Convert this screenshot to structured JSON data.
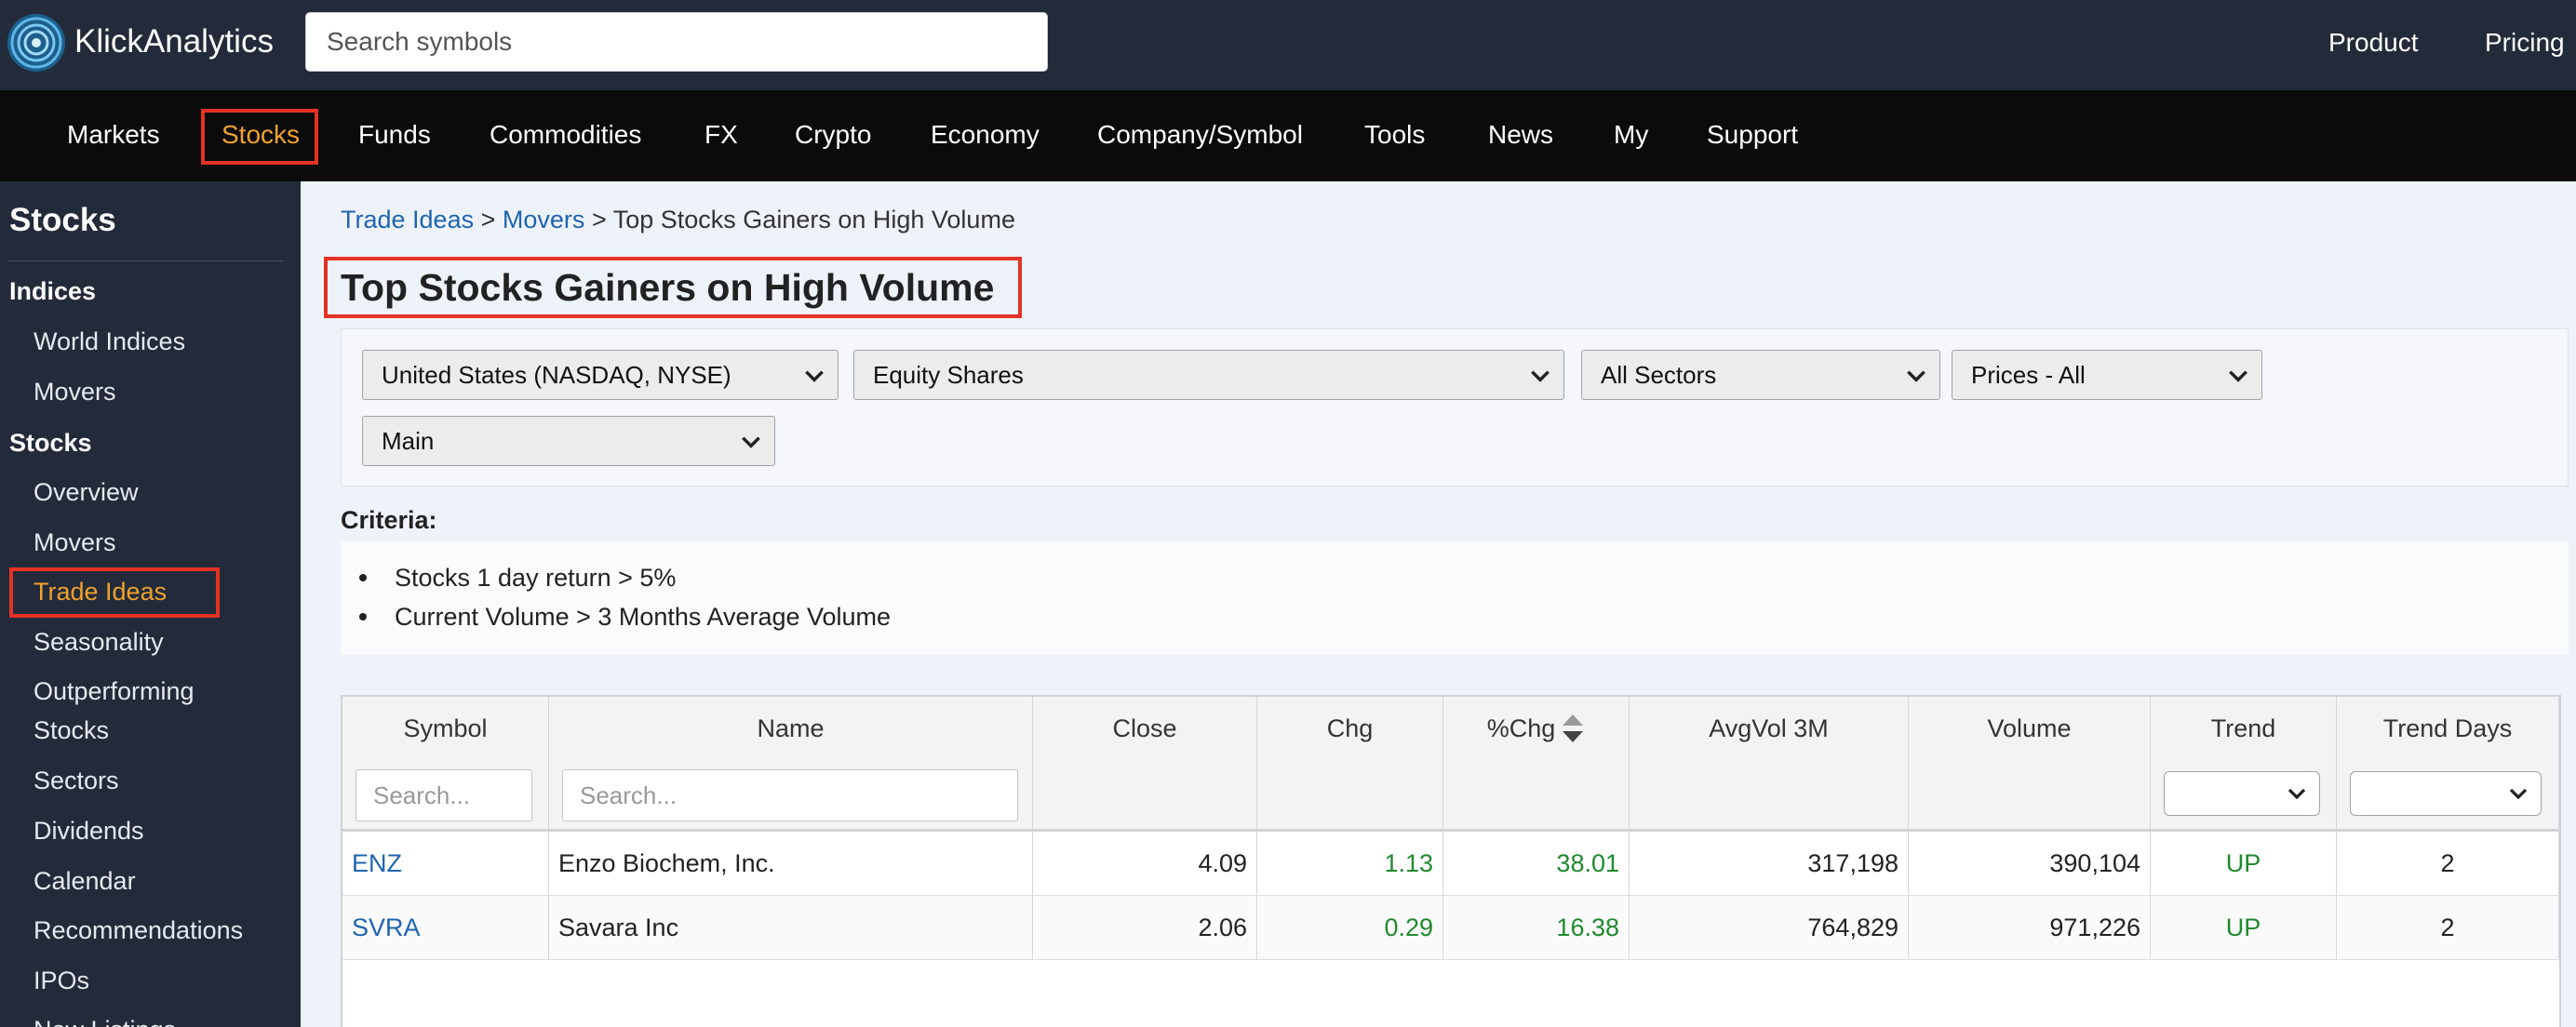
{
  "header": {
    "brand": "KlickAnalytics",
    "search_placeholder": "Search symbols",
    "links": [
      "Product",
      "Pricing"
    ]
  },
  "nav": {
    "items": [
      "Markets",
      "Stocks",
      "Funds",
      "Commodities",
      "FX",
      "Crypto",
      "Economy",
      "Company/Symbol",
      "Tools",
      "News",
      "My",
      "Support"
    ],
    "active": "Stocks"
  },
  "sidebar": {
    "title": "Stocks",
    "section_indices": "Indices",
    "indices_items": [
      "World Indices",
      "Movers"
    ],
    "section_stocks": "Stocks",
    "stocks_items": [
      "Overview",
      "Movers",
      "Trade Ideas",
      "Seasonality",
      "Outperforming",
      "Stocks",
      "Sectors",
      "Dividends",
      "Calendar",
      "Recommendations",
      "IPOs",
      "New Listings"
    ],
    "active": "Trade Ideas"
  },
  "breadcrumb": {
    "items": [
      "Trade Ideas",
      "Movers"
    ],
    "separator": ">",
    "current": "Top Stocks Gainers on High Volume"
  },
  "page_title": "Top Stocks Gainers on High Volume",
  "filters": {
    "market": "United States (NASDAQ, NYSE)",
    "asset_type": "Equity Shares",
    "sector": "All Sectors",
    "price": "Prices - All",
    "view": "Main"
  },
  "criteria": {
    "label": "Criteria:",
    "items": [
      "Stocks 1 day return > 5%",
      "Current Volume > 3 Months Average Volume"
    ]
  },
  "table": {
    "columns": [
      "Symbol",
      "Name",
      "Close",
      "Chg",
      "%Chg",
      "AvgVol 3M",
      "Volume",
      "Trend",
      "Trend Days"
    ],
    "symbol_search_placeholder": "Search...",
    "name_search_placeholder": "Search...",
    "rows": [
      {
        "symbol": "ENZ",
        "name": "Enzo Biochem, Inc.",
        "close": "4.09",
        "chg": "1.13",
        "pchg": "38.01",
        "avgvol": "317,198",
        "volume": "390,104",
        "trend": "UP",
        "trend_days": "2"
      },
      {
        "symbol": "SVRA",
        "name": "Savara Inc",
        "close": "2.06",
        "chg": "0.29",
        "pchg": "16.38",
        "avgvol": "764,829",
        "volume": "971,226",
        "trend": "UP",
        "trend_days": "2"
      }
    ]
  },
  "colors": {
    "header_bg": "#232b3a",
    "nav_bg": "#0b0b0b",
    "active_orange": "#f0a22e",
    "highlight_red": "#e53225",
    "link_blue": "#1f64b0",
    "positive_green": "#1f8a2e"
  },
  "icons": {
    "logo": "klickanalytics-swirl-logo",
    "dropdown": "chevron-down-icon",
    "sort": "sort-updown-icon"
  }
}
